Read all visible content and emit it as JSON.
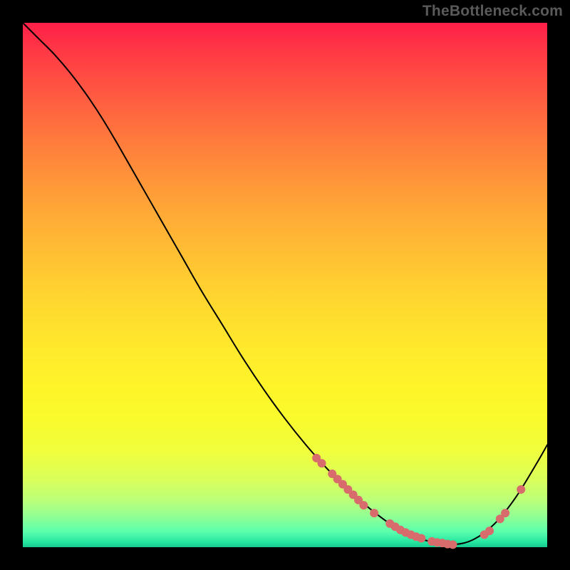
{
  "watermark": "TheBottleneck.com",
  "colors": {
    "page_bg": "#000000",
    "curve": "#000000",
    "marker": "#d86b6b",
    "gradient_top": "#ff1f49",
    "gradient_bottom": "#17c98f",
    "watermark_text": "#5a5a5a"
  },
  "chart_data": {
    "type": "line",
    "title": "",
    "xlabel": "",
    "ylabel": "",
    "xlim": [
      0,
      100
    ],
    "ylim": [
      0,
      100
    ],
    "series": [
      {
        "name": "bottleneck-curve",
        "x": [
          0,
          3,
          6,
          9,
          12,
          15,
          18,
          22,
          26,
          30,
          34,
          38,
          42,
          46,
          50,
          54,
          58,
          62,
          66,
          70,
          74,
          78,
          82,
          86,
          90,
          94,
          98,
          100
        ],
        "y": [
          100,
          97,
          94,
          90.5,
          86.5,
          82,
          77,
          70,
          63,
          56,
          49,
          42.5,
          36,
          30,
          24.5,
          19.5,
          15,
          11,
          7.5,
          4.5,
          2.3,
          1,
          0.5,
          1.5,
          4.5,
          9.5,
          16,
          19.5
        ]
      }
    ],
    "markers": {
      "name": "highlighted-points",
      "x": [
        56,
        57,
        59,
        60,
        61,
        62,
        63,
        64,
        65,
        67,
        70,
        71,
        72,
        73,
        74,
        75,
        76,
        78,
        79,
        80,
        81,
        82,
        88,
        89,
        91,
        92,
        95
      ],
      "y": [
        17,
        16,
        14,
        13,
        12,
        11,
        10,
        9,
        8,
        6.5,
        4.5,
        3.9,
        3.3,
        2.8,
        2.4,
        2.0,
        1.7,
        1.1,
        0.9,
        0.8,
        0.6,
        0.5,
        2.4,
        3.1,
        5.4,
        6.5,
        11
      ]
    }
  }
}
